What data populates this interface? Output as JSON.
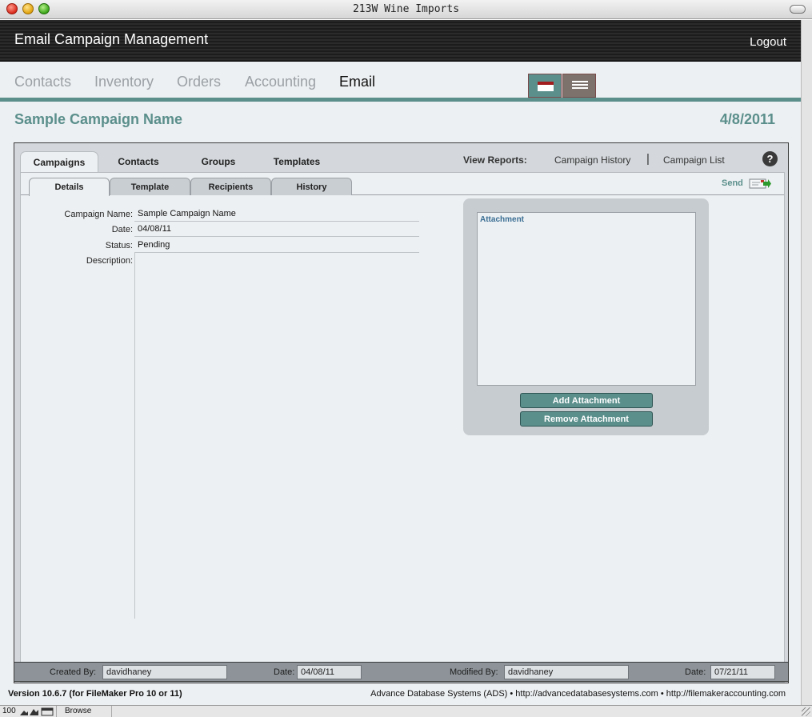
{
  "window": {
    "title": "213W Wine Imports"
  },
  "header": {
    "title": "Email Campaign Management",
    "logout_label": "Logout"
  },
  "nav": {
    "items": [
      {
        "label": "Contacts",
        "active": false
      },
      {
        "label": "Inventory",
        "active": false
      },
      {
        "label": "Orders",
        "active": false
      },
      {
        "label": "Accounting",
        "active": false
      },
      {
        "label": "Email",
        "active": true
      }
    ],
    "view_buttons": [
      {
        "name": "form-view",
        "icon": "form-view-icon",
        "active": true
      },
      {
        "name": "list-view",
        "icon": "list-view-icon",
        "active": false
      }
    ]
  },
  "record": {
    "title": "Sample Campaign Name",
    "date": "4/8/2011"
  },
  "main_tabs": [
    {
      "label": "Campaigns",
      "active": true
    },
    {
      "label": "Contacts",
      "active": false
    },
    {
      "label": "Groups",
      "active": false
    },
    {
      "label": "Templates",
      "active": false
    }
  ],
  "reports": {
    "label": "View Reports:",
    "links": [
      "Campaign History",
      "Campaign List"
    ],
    "separator": "|",
    "help_symbol": "?"
  },
  "sub_tabs": [
    {
      "label": "Details",
      "active": true
    },
    {
      "label": "Template",
      "active": false
    },
    {
      "label": "Recipients",
      "active": false
    },
    {
      "label": "History",
      "active": false
    }
  ],
  "send": {
    "label": "Send",
    "icon": "send-email-icon"
  },
  "details": {
    "fields": [
      {
        "label": "Campaign Name:",
        "value": "Sample Campaign Name"
      },
      {
        "label": "Date:",
        "value": "04/08/11"
      },
      {
        "label": "Status:",
        "value": "Pending"
      },
      {
        "label": "Description:",
        "value": ""
      }
    ]
  },
  "attachment": {
    "label": "Attachment",
    "add_label": "Add Attachment",
    "remove_label": "Remove Attachment"
  },
  "footer": {
    "created_by_label": "Created By:",
    "created_by": "davidhaney",
    "created_date_label": "Date:",
    "created_date": "04/08/11",
    "modified_by_label": "Modified By:",
    "modified_by": "davidhaney",
    "modified_date_label": "Date:",
    "modified_date": "07/21/11"
  },
  "version_text": "Version 10.6.7 (for FileMaker Pro 10 or 11)",
  "credits_text": "Advance Database Systems (ADS) • http://advancedatabasesystems.com • http://filemakeraccounting.com",
  "statusbar": {
    "zoom": "100",
    "mode": "Browse"
  },
  "colors": {
    "accent": "#5b8f8c",
    "header_bg": "#222222",
    "panel_bg": "#edf0f2"
  }
}
